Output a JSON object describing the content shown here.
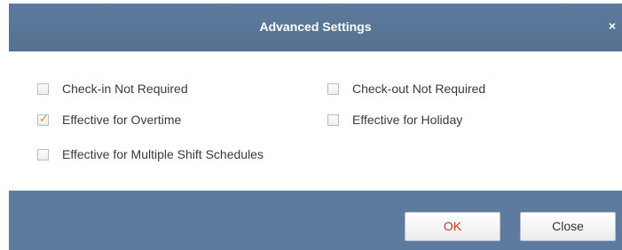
{
  "dialog": {
    "title": "Advanced Settings",
    "close_glyph": "×"
  },
  "options": [
    {
      "label": "Check-in Not Required",
      "checked": false
    },
    {
      "label": "Check-out Not Required",
      "checked": false
    },
    {
      "label": "Effective for Overtime",
      "checked": true
    },
    {
      "label": "Effective for Holiday",
      "checked": false
    },
    {
      "label": "Effective for Multiple Shift Schedules",
      "checked": false
    }
  ],
  "check_glyph": "✓",
  "buttons": {
    "ok_label": "OK",
    "close_label": "Close"
  },
  "colors": {
    "titlebar": "#5d7b9e",
    "check_mark": "#d98a26",
    "ok_text": "#c0392b"
  }
}
